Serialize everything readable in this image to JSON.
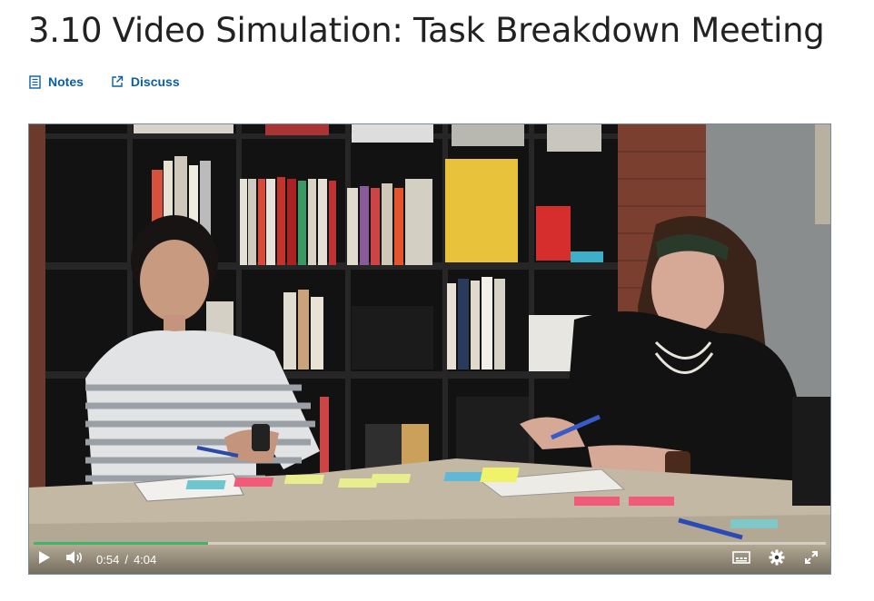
{
  "page": {
    "title": "3.10 Video Simulation: Task Breakdown Meeting"
  },
  "actions": {
    "notes_label": "Notes",
    "discuss_label": "Discuss"
  },
  "player": {
    "current_time": "0:54",
    "separator": "/",
    "duration": "4:04",
    "progress_fraction": 0.22,
    "accent_color": "#41b46b",
    "icons": [
      "play-icon",
      "volume-icon",
      "captions-icon",
      "settings-icon",
      "fullscreen-icon"
    ]
  },
  "colors": {
    "link": "#0a5ea8",
    "title": "#222222"
  }
}
